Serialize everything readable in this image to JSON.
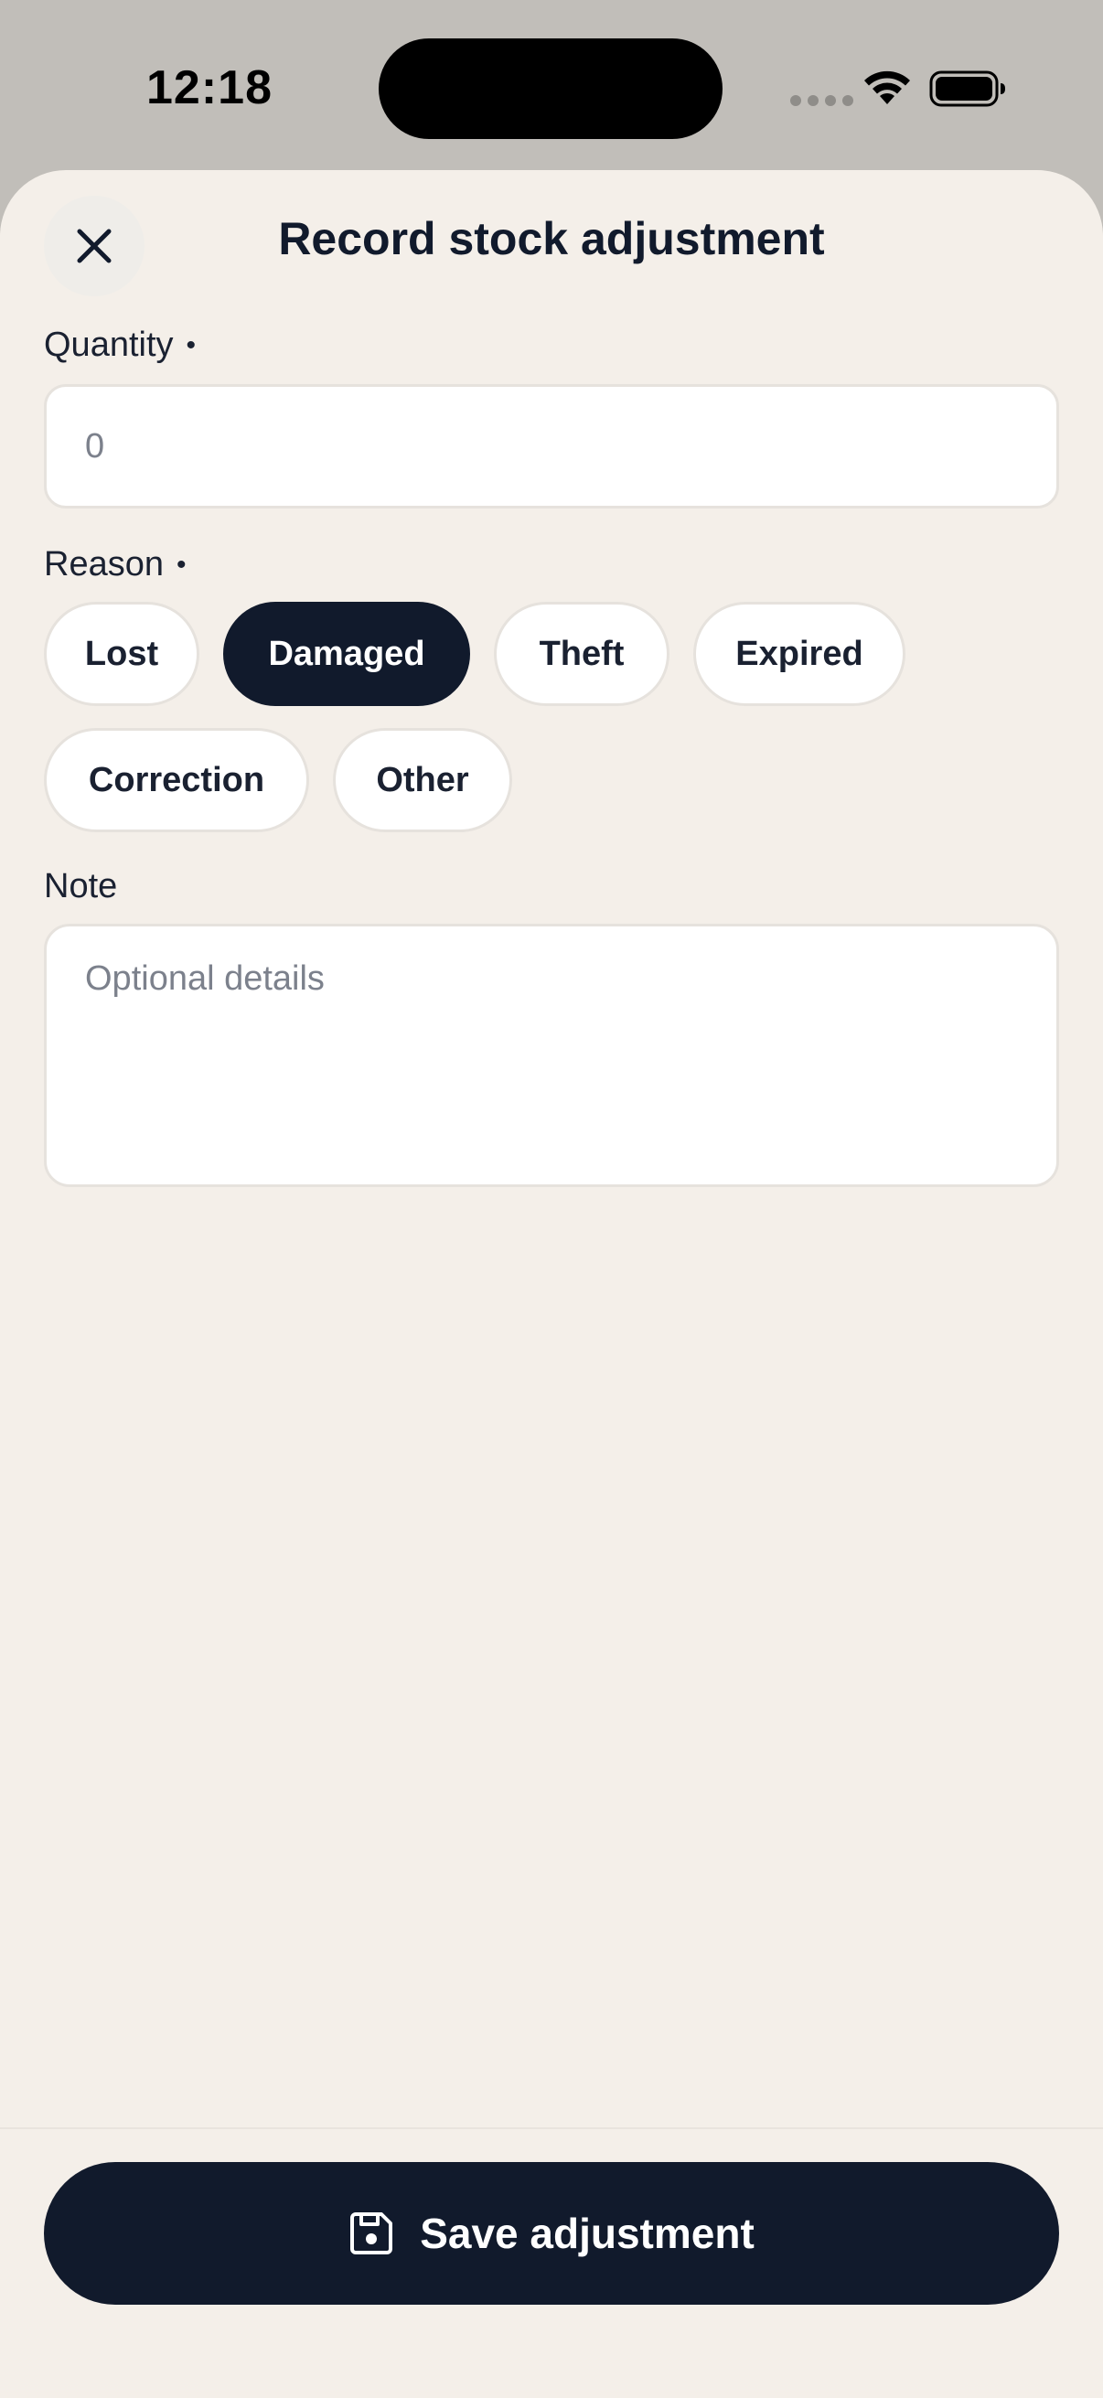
{
  "status_bar": {
    "time": "12:18"
  },
  "sheet": {
    "title": "Record stock adjustment",
    "close_icon": "close-icon"
  },
  "quantity": {
    "label": "Quantity",
    "required_marker": "•",
    "placeholder": "0",
    "value": ""
  },
  "reason": {
    "label": "Reason",
    "required_marker": "•",
    "selected": "Damaged",
    "options": [
      "Lost",
      "Damaged",
      "Theft",
      "Expired",
      "Correction",
      "Other"
    ]
  },
  "note": {
    "label": "Note",
    "placeholder": "Optional details",
    "value": ""
  },
  "footer": {
    "save_label": "Save adjustment",
    "save_icon": "save-icon"
  },
  "colors": {
    "sheet_bg": "#f4efe9",
    "primary": "#111a2c",
    "input_bg": "#ffffff",
    "placeholder": "#7c818c"
  }
}
